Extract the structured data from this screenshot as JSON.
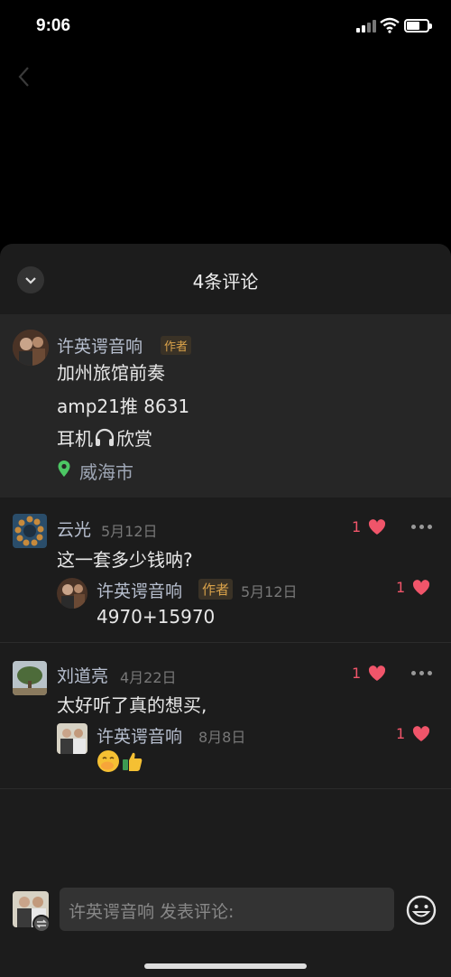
{
  "status_bar": {
    "time": "9:06",
    "battery_level": 0.65
  },
  "sheet": {
    "title": "4条评论"
  },
  "post": {
    "author": "许英谔音响",
    "author_tag": "作者",
    "lines": [
      "加州旅馆前奏",
      "amp21推 8631",
      "耳机",
      "欣赏"
    ],
    "location": "威海市"
  },
  "comments": [
    {
      "name": "云光",
      "date": "5月12日",
      "text": "这一套多少钱呐?",
      "likes": "1",
      "reply": {
        "name": "许英谔音响",
        "tag": "作者",
        "date": "5月12日",
        "text": "4970+15970",
        "likes": "1"
      }
    },
    {
      "name": "刘道亮",
      "date": "4月22日",
      "text": "太好听了真的想买,",
      "likes": "1",
      "reply": {
        "name": "许英谔音响",
        "date": "8月8日",
        "likes": "1",
        "emojis": [
          "face-with-hand-over-mouth",
          "thumbs-up"
        ]
      }
    }
  ],
  "composer": {
    "placeholder": "许英谔音响 发表评论:"
  },
  "colors": {
    "like": "#f0556a",
    "author_tag": "#d9a24a",
    "location_pin": "#4cc764"
  }
}
